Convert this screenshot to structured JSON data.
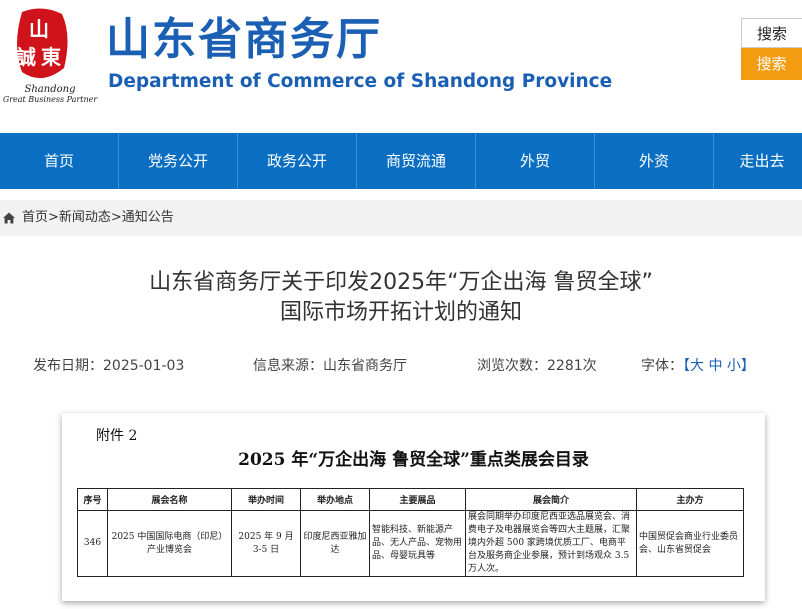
{
  "header": {
    "logo": {
      "seal_text": "山東誠",
      "sub_line1": "Shandong",
      "sub_line2": "Great Business Partner",
      "seal_color": "#d0121b"
    },
    "title": "山东省商务厅",
    "subtitle": "Department of Commerce of Shandong Province",
    "search_box_text": "搜索",
    "search_button": "搜索"
  },
  "nav": {
    "items": [
      "首页",
      "党务公开",
      "政务公开",
      "商贸流通",
      "外贸",
      "外资",
      "走出去"
    ]
  },
  "breadcrumb": {
    "icon": "home-icon",
    "path": "首页>新闻动态>通知公告"
  },
  "article": {
    "title_line1": "山东省商务厅关于印发2025年“万企出海 鲁贸全球”",
    "title_line2": "国际市场开拓计划的通知",
    "meta": {
      "date_label": "发布日期：",
      "date": "2025-01-03",
      "source_label": "信息来源：",
      "source": "山东省商务厅",
      "views_label": "浏览次数：",
      "views": "2281次",
      "font_label": "字体：",
      "font_open": "【",
      "font_large": "大",
      "font_medium": "中",
      "font_small": "小",
      "font_close": "】"
    }
  },
  "document": {
    "attachment": "附件 2",
    "title": "2025 年“万企出海  鲁贸全球”重点类展会目录",
    "columns": [
      "序号",
      "展会名称",
      "举办时间",
      "举办地点",
      "主要展品",
      "展会简介",
      "主办方"
    ],
    "rows": [
      {
        "no": "346",
        "name": "2025 中国国际电商（印尼）产业博览会",
        "time": "2025 年 9 月 3-5 日",
        "place": "印度尼西亚雅加达",
        "products": "智能科技、新能源产品、无人产品、宠物用品、母婴玩具等",
        "intro": "展会同期举办印度尼西亚选品展览会、消费电子及电器展览会等四大主题展，汇聚境内外超 500 家跨境优质工厂、电商平台及服务商企业参展，预计到场观众 3.5 万人次。",
        "organizer": "中国贸促会商业行业委员会、山东省贸促会"
      }
    ]
  },
  "colors": {
    "brand_blue": "#1a5fb4",
    "nav_blue": "#0a6fc2",
    "search_orange": "#f39c12"
  }
}
